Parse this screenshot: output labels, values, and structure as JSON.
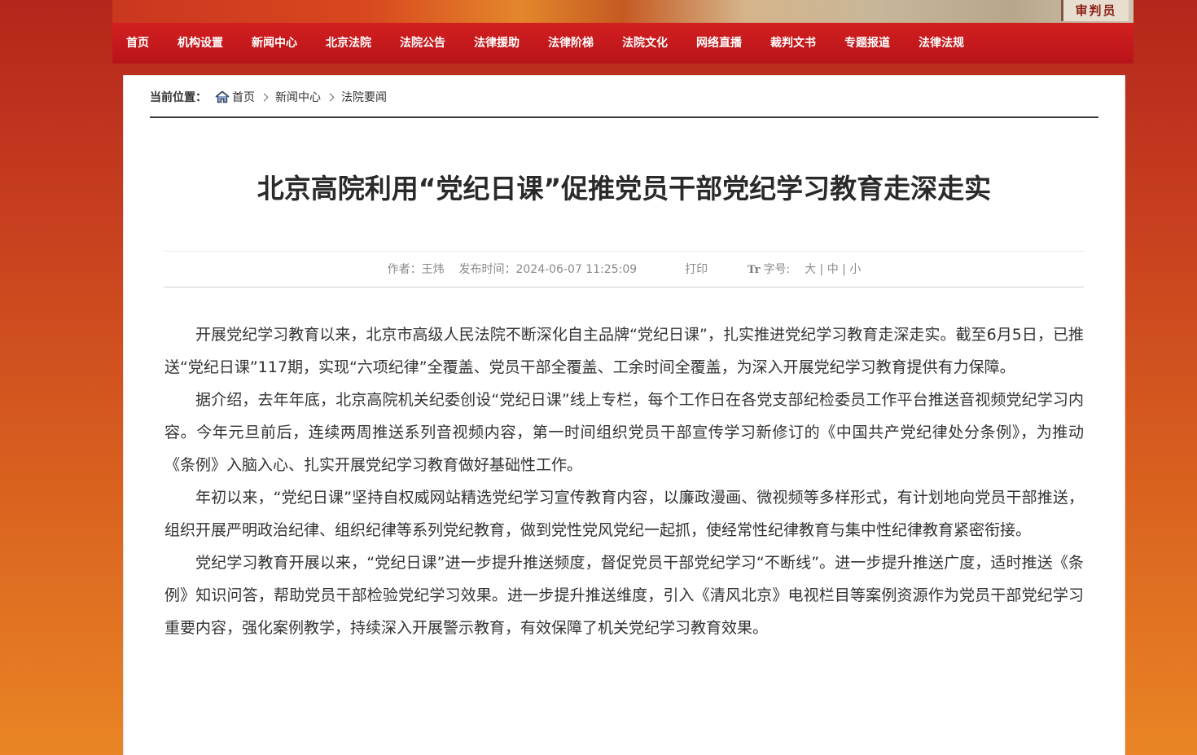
{
  "banner": {
    "sign_text": "审判员"
  },
  "nav": {
    "items": [
      {
        "label": "首页"
      },
      {
        "label": "机构设置"
      },
      {
        "label": "新闻中心"
      },
      {
        "label": "北京法院"
      },
      {
        "label": "法院公告"
      },
      {
        "label": "法律援助"
      },
      {
        "label": "法律阶梯"
      },
      {
        "label": "法院文化"
      },
      {
        "label": "网络直播"
      },
      {
        "label": "裁判文书"
      },
      {
        "label": "专题报道"
      },
      {
        "label": "法律法规"
      }
    ]
  },
  "breadcrumb": {
    "label": "当前位置：",
    "items": [
      {
        "label": "首页"
      },
      {
        "label": "新闻中心"
      },
      {
        "label": "法院要闻"
      }
    ]
  },
  "article": {
    "title": "北京高院利用“党纪日课”促推党员干部党纪学习教育走深走实",
    "meta": {
      "author": "作者：王炜",
      "published": "发布时间：2024-06-07 11:25:09",
      "print": "打印",
      "font_size_label": "字号:",
      "size_large": "大",
      "size_medium": "中",
      "size_small": "小",
      "separator": "|"
    },
    "paragraphs": [
      "开展党纪学习教育以来，北京市高级人民法院不断深化自主品牌“党纪日课”，扎实推进党纪学习教育走深走实。截至6月5日，已推送“党纪日课”117期，实现“六项纪律”全覆盖、党员干部全覆盖、工余时间全覆盖，为深入开展党纪学习教育提供有力保障。",
      "据介绍，去年年底，北京高院机关纪委创设“党纪日课”线上专栏，每个工作日在各党支部纪检委员工作平台推送音视频党纪学习内容。今年元旦前后，连续两周推送系列音视频内容，第一时间组织党员干部宣传学习新修订的《中国共产党纪律处分条例》，为推动《条例》入脑入心、扎实开展党纪学习教育做好基础性工作。",
      "年初以来，“党纪日课”坚持自权威网站精选党纪学习宣传教育内容，以廉政漫画、微视频等多样形式，有计划地向党员干部推送，组织开展严明政治纪律、组织纪律等系列党纪教育，做到党性党风党纪一起抓，使经常性纪律教育与集中性纪律教育紧密衔接。",
      "党纪学习教育开展以来，“党纪日课”进一步提升推送频度，督促党员干部党纪学习“不断线”。进一步提升推送广度，适时推送《条例》知识问答，帮助党员干部检验党纪学习效果。进一步提升推送维度，引入《清风北京》电视栏目等案例资源作为党员干部党纪学习重要内容，强化案例教学，持续深入开展警示教育，有效保障了机关党纪学习教育效果。"
    ]
  },
  "colors": {
    "nav_red": "#c8181c",
    "page_bg_top": "#b3261c",
    "page_bg_bottom": "#e98525",
    "text_main": "#333333",
    "meta_gray": "#8a8a8a"
  }
}
